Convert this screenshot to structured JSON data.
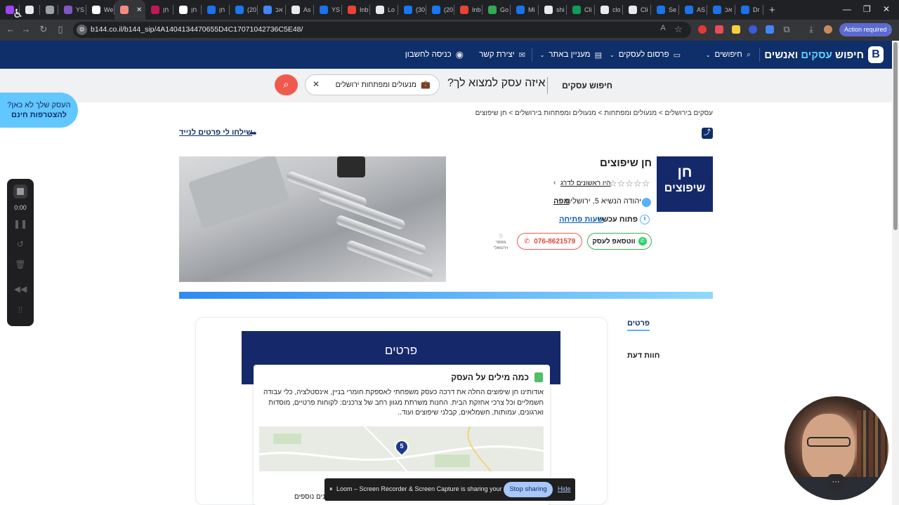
{
  "browser": {
    "tabs": [
      {
        "label": "",
        "color": "#a142f4"
      },
      {
        "label": "",
        "color": "#e8eaed"
      },
      {
        "label": "",
        "color": "#9aa0a6"
      },
      {
        "label": "YS",
        "color": "#7e57c2"
      },
      {
        "label": "We",
        "color": "#ffffff"
      },
      {
        "label": "",
        "color": "#f28b82",
        "active": true
      },
      {
        "label": "חן",
        "color": "#c2185b"
      },
      {
        "label": "חן",
        "color": "#ffffff"
      },
      {
        "label": "חן",
        "color": "#1a73e8"
      },
      {
        "label": "(20",
        "color": "#1877f2"
      },
      {
        "label": "אכ",
        "color": "#4285f4"
      },
      {
        "label": "As",
        "color": "#e8eaed"
      },
      {
        "label": "YS",
        "color": "#1a73e8"
      },
      {
        "label": "Inb",
        "color": "#ea4335"
      },
      {
        "label": "Lo",
        "color": "#e8eaed"
      },
      {
        "label": "(30",
        "color": "#1877f2"
      },
      {
        "label": "(20",
        "color": "#1877f2"
      },
      {
        "label": "Inb",
        "color": "#ea4335"
      },
      {
        "label": "Go",
        "color": "#34a853"
      },
      {
        "label": "Mi",
        "color": "#1a73e8"
      },
      {
        "label": "shi",
        "color": "#e8eaed"
      },
      {
        "label": "Cli",
        "color": "#0f9d58"
      },
      {
        "label": "clo",
        "color": "#e8eaed"
      },
      {
        "label": "Cli",
        "color": "#e8eaed"
      },
      {
        "label": "Se",
        "color": "#1a73e8"
      },
      {
        "label": "AS",
        "color": "#1a73e8"
      },
      {
        "label": "אכ",
        "color": "#1a73e8"
      },
      {
        "label": "Dr",
        "color": "#1a73e8"
      }
    ],
    "new_tab_glyph": "+",
    "window_controls": {
      "minimize": "—",
      "restore": "❐",
      "close": "✕"
    },
    "url": "b144.co.il/b144_sip/4A1404134470655D4C17071042736C5E48/",
    "action_required": "Action required"
  },
  "site": {
    "logo_word1": "חיפוש",
    "logo_word2": "עסקים",
    "logo_word3": "ואנשים",
    "logo_mark": "B",
    "nav": {
      "people_search": "חיפושים",
      "advertise": "פרסום לעסקים",
      "interesting": "מעניין באתר",
      "contact": "יצירת קשר",
      "login": "כניסה לחשבון"
    }
  },
  "search": {
    "type_label": "חיפוש עסקים",
    "question": "איזה עסק למצוא לך?",
    "value": "מנעולים ומפתחות ירושלים"
  },
  "promo": {
    "line1": "העסק שלך לא כאן?",
    "line2": "להצטרפות חינם"
  },
  "loom": {
    "time": "0:00",
    "banner_message": "Loom – Screen Recorder & Screen Capture is sharing your screen.",
    "stop_sharing": "Stop sharing",
    "hide": "Hide"
  },
  "breadcrumb": "עסקים בירושלים > מנעולים ומפתחות > מנעולים ומפתחות בירושלים > חן שיפוצים",
  "send_details": "שילחו לי פרטים לנייד",
  "business": {
    "logo_line1": "חן",
    "logo_line2": "שיפוצים",
    "name": "חן שיפוצים",
    "rating_stars": 0,
    "first_review": "היו ראשונים לדרג",
    "address": "יהודה הנשיא 5, ירושלים",
    "map_link": "מפה",
    "open_status": "פתוח עכשיו",
    "hours_link": "שעות פתיחה",
    "whatsapp": "ווטסאפ לעסק",
    "phone": "076-8621579",
    "virtual_number": "מספר וירטואלי",
    "whatsapp_color": "#25d366",
    "accent_color": "#f05a4e"
  },
  "side_tabs": {
    "details": "פרטים",
    "reviews": "חוות דעת"
  },
  "details": {
    "title": "פרטים",
    "about_title": "כמה מילים על העסק",
    "about_text": "אודותינו חן שיפוצים החלה את דרכה כעסק משפחתי לאספקת חומרי בניין, אינסטלציה, כלי עבודה חשמליים וכל צרכי אחזקת הבית. החנות משרתת מגוון רחב של צרכנים: לקוחות פרטיים, מוסדות וארגונים, עמותות, חשמלאים, קבלני שיפוצים ועוד..",
    "map_pin_label": "5",
    "more_text": "נים נוספים"
  }
}
